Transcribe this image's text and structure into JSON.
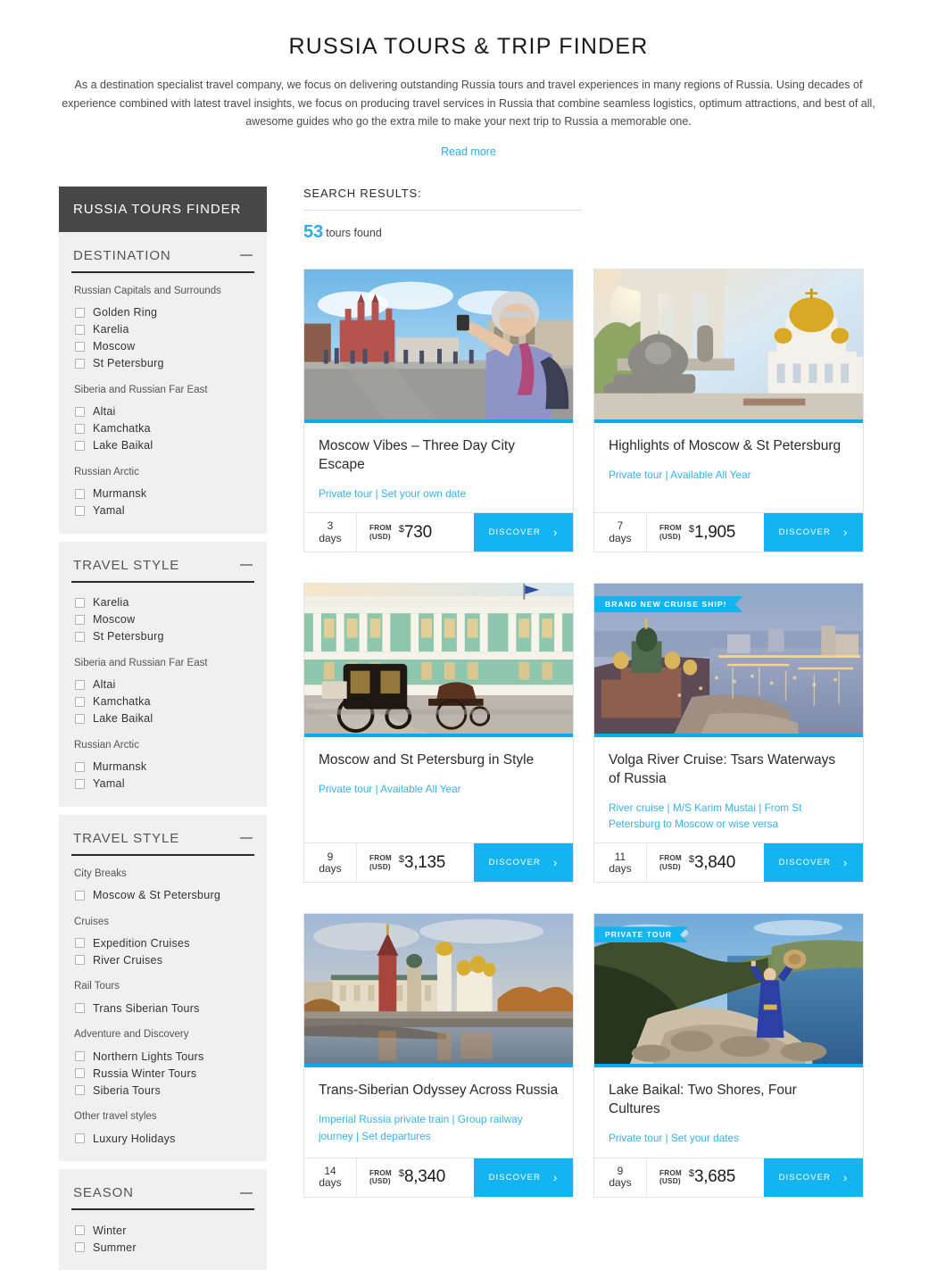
{
  "header": {
    "title": "RUSSIA TOURS & TRIP FINDER",
    "intro": "As a destination specialist travel company, we focus on delivering outstanding Russia tours and travel experiences in many regions of Russia. Using decades of experience combined with latest travel insights, we focus on producing travel services in Russia that combine seamless logistics, optimum attractions, and best of all, awesome guides who go the extra mile to make your next trip to Russia a memorable one.",
    "read_more": "Read more"
  },
  "sidebar": {
    "finder_title": "RUSSIA TOURS FINDER",
    "collapse_icon": "minus-icon",
    "blocks": [
      {
        "title": "DESTINATION",
        "groups": [
          {
            "label": "Russian Capitals and Surrounds",
            "options": [
              "Golden Ring",
              "Karelia",
              "Moscow",
              "St Petersburg"
            ]
          },
          {
            "label": "Siberia and Russian Far East",
            "options": [
              "Altai",
              "Kamchatka",
              "Lake Baikal"
            ]
          },
          {
            "label": "Russian Arctic",
            "options": [
              "Murmansk",
              "Yamal"
            ]
          }
        ]
      },
      {
        "title": "TRAVEL STYLE",
        "groups": [
          {
            "label": "",
            "options": [
              "Karelia",
              "Moscow",
              "St Petersburg"
            ]
          },
          {
            "label": "Siberia and Russian Far East",
            "options": [
              "Altai",
              "Kamchatka",
              "Lake Baikal"
            ]
          },
          {
            "label": "Russian Arctic",
            "options": [
              "Murmansk",
              "Yamal"
            ]
          }
        ]
      },
      {
        "title": "TRAVEL STYLE",
        "groups": [
          {
            "label": "City Breaks",
            "options": [
              "Moscow & St Petersburg"
            ]
          },
          {
            "label": "Cruises",
            "options": [
              "Expedition Cruises",
              "River Cruises"
            ]
          },
          {
            "label": "Rail Tours",
            "options": [
              "Trans Siberian Tours"
            ]
          },
          {
            "label": "Adventure and Discovery",
            "options": [
              "Northern Lights Tours",
              "Russia Winter Tours",
              "Siberia Tours"
            ]
          },
          {
            "label": "Other travel styles",
            "options": [
              "Luxury Holidays"
            ]
          }
        ]
      },
      {
        "title": "SEASON",
        "groups": [
          {
            "label": "",
            "options": [
              "Winter",
              "Summer"
            ]
          }
        ]
      }
    ]
  },
  "results": {
    "heading": "SEARCH RESULTS:",
    "count": "53",
    "count_suffix": "tours found",
    "from_label_line1": "FROM",
    "from_label_line2": "(USD)",
    "days_word": "days",
    "discover_label": "DISCOVER",
    "chevron": "›",
    "accent_color": "#00aeef",
    "cards": [
      {
        "title": "Moscow Vibes – Three Day City Escape",
        "subtitle": "Private tour | Set your own date",
        "days": "3",
        "currency": "$",
        "price": "730",
        "badge": "",
        "image": "red-square-selfie-tourist"
      },
      {
        "title": "Highlights of Moscow & St Petersburg",
        "subtitle": "Private tour | Available All Year",
        "days": "7",
        "currency": "$",
        "price": "1,905",
        "badge": "",
        "image": "cathedral-christ-saviour-lion-statue"
      },
      {
        "title": "Moscow and St Petersburg in Style",
        "subtitle": "Private tour | Available All Year",
        "days": "9",
        "currency": "$",
        "price": "3,135",
        "badge": "",
        "image": "winter-palace-horse-carriage"
      },
      {
        "title": "Volga River Cruise: Tsars Waterways of Russia",
        "subtitle": "River cruise | M/S Karim Mustai | From St Petersburg to Moscow or wise versa",
        "days": "11",
        "currency": "$",
        "price": "3,840",
        "badge": "BRAND NEW CRUISE SHIP!",
        "image": "river-city-night-lights"
      },
      {
        "title": "Trans-Siberian Odyssey Across Russia",
        "subtitle": "Imperial Russia private train | Group railway journey | Set departures",
        "days": "14",
        "currency": "$",
        "price": "8,340",
        "badge": "",
        "image": "moscow-kremlin-river-bridge"
      },
      {
        "title": "Lake Baikal: Two Shores, Four Cultures",
        "subtitle": "Private tour | Set your dates",
        "days": "9",
        "currency": "$",
        "price": "3,685",
        "badge": "PRIVATE TOUR",
        "image": "lake-baikal-shaman-cliff"
      }
    ]
  }
}
